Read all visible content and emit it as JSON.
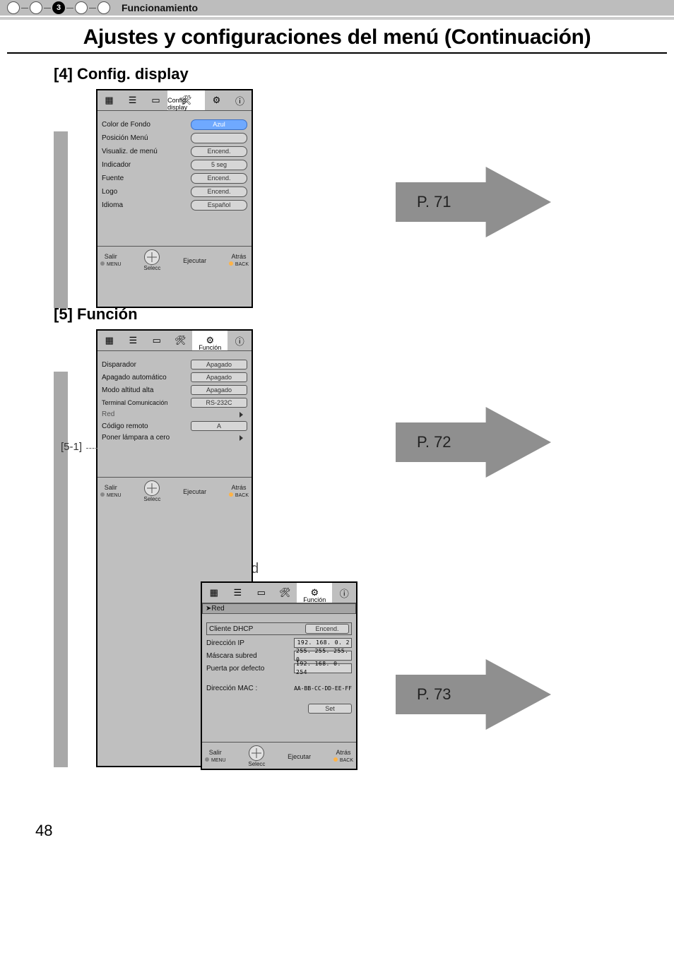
{
  "page_number": "48",
  "header": {
    "breadcrumb": "Funcionamiento",
    "active_step": "3"
  },
  "title": "Ajustes y configuraciones del menú (Continuación)",
  "sections": {
    "s4": {
      "heading": "[4] Config. display",
      "arrow_label": "P. 71",
      "osd": {
        "tab_label": "Config. display",
        "rows": [
          {
            "label": "Color de Fondo",
            "value": "Azul",
            "style": "blue"
          },
          {
            "label": "Posición Menú",
            "value": "",
            "style": "blank"
          },
          {
            "label": "Visualiz. de menú",
            "value": "Encend."
          },
          {
            "label": "Indicador",
            "value": "5 seg"
          },
          {
            "label": "Fuente",
            "value": "Encend."
          },
          {
            "label": "Logo",
            "value": "Encend."
          },
          {
            "label": "Idioma",
            "value": "Español"
          }
        ],
        "footer": {
          "salir": "Salir",
          "menu": "MENU",
          "selecc": "Selecc",
          "ejecutar": "Ejecutar",
          "atras": "Atrás",
          "back": "BACK"
        }
      }
    },
    "s5": {
      "heading": "[5] Función",
      "arrow_label": "P. 72",
      "annot_label": "[5-1]",
      "osd": {
        "tab_label": "Función",
        "rows": [
          {
            "label": "Disparador",
            "value": "Apagado"
          },
          {
            "label": "Apagado automático",
            "value": "Apagado"
          },
          {
            "label": "Modo altitud alta",
            "value": "Apagado"
          },
          {
            "label": "Terminal Comunicación",
            "value": "RS-232C"
          },
          {
            "label": "Red",
            "value": "",
            "style": "arrow"
          },
          {
            "label": "Código remoto",
            "value": "A"
          },
          {
            "label": "Poner lámpara a cero",
            "value": "",
            "style": "arrow"
          }
        ],
        "footer": {
          "salir": "Salir",
          "menu": "MENU",
          "selecc": "Selecc",
          "ejecutar": "Ejecutar",
          "atras": "Atrás",
          "back": "BACK"
        }
      }
    },
    "s51": {
      "heading": "[5-1] Red",
      "arrow_label": "P. 73",
      "osd": {
        "tab_label": "Función",
        "sub_header": "Red",
        "rows": [
          {
            "label": "Cliente DHCP",
            "value": "Encend.",
            "style": "pill"
          },
          {
            "label": "Dirección IP",
            "value": "192. 168.    0.     2",
            "style": "ip"
          },
          {
            "label": "Máscara subred",
            "value": "255. 255. 255.     0",
            "style": "ip"
          },
          {
            "label": "Puerta por defecto",
            "value": "192. 168.    0. 254",
            "style": "ip"
          },
          {
            "label": "Dirección MAC    :",
            "value": "AA-BB-CC-DD-EE-FF",
            "style": "text"
          },
          {
            "label": "",
            "value": "Set",
            "style": "pill"
          }
        ],
        "footer": {
          "salir": "Salir",
          "menu": "MENU",
          "selecc": "Selecc",
          "ejecutar": "Ejecutar",
          "atras": "Atrás",
          "back": "BACK"
        }
      }
    }
  }
}
